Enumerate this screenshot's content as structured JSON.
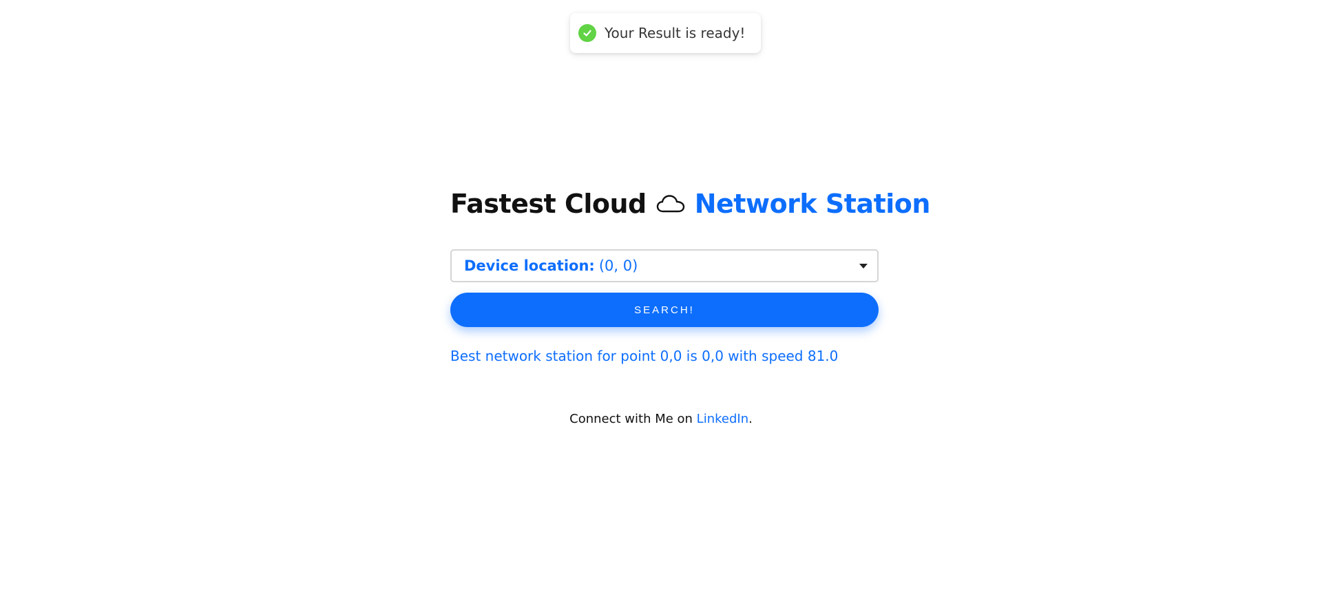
{
  "toast": {
    "message": "Your Result is ready!",
    "icon": "check-circle-icon",
    "color": "#61d345"
  },
  "header": {
    "title_part1": "Fastest Cloud",
    "title_icon": "cloud-icon",
    "title_part2": "Network Station"
  },
  "form": {
    "select_label": "Device location:",
    "select_value": "(0, 0)",
    "search_label": "SEARCH!"
  },
  "result": {
    "text": "Best network station for point 0,0 is 0,0 with speed 81.0"
  },
  "footer": {
    "prefix": "Connect with Me on ",
    "link_label": "LinkedIn",
    "suffix": "."
  },
  "colors": {
    "accent": "#0d6efd",
    "success": "#61d345",
    "text": "#111111"
  }
}
